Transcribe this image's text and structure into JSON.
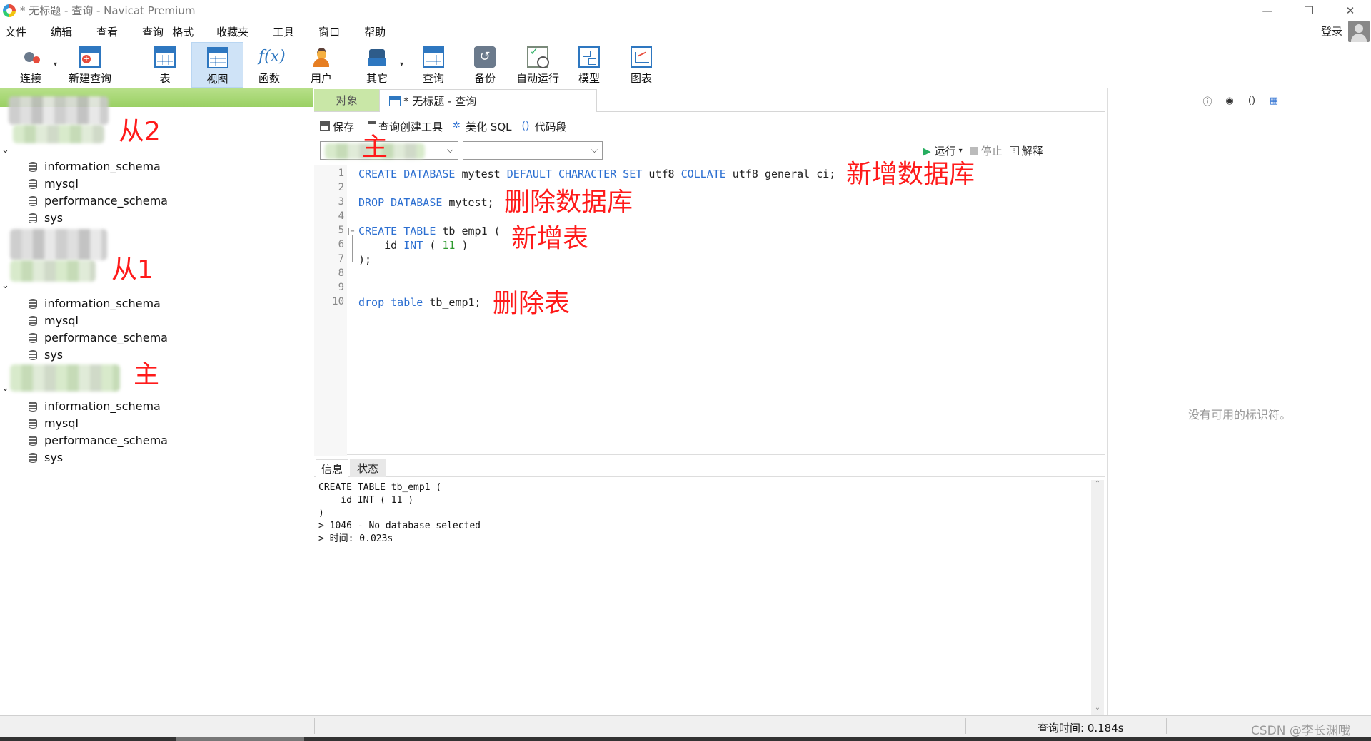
{
  "window": {
    "title": "* 无标题 - 查询 - Navicat Premium",
    "controls": [
      "—",
      "❐",
      "✕"
    ]
  },
  "menu": {
    "items": [
      "文件",
      "编辑",
      "查看",
      "查询",
      "格式",
      "收藏夹",
      "工具",
      "窗口",
      "帮助"
    ],
    "login": "登录"
  },
  "toolbar": {
    "items": [
      {
        "label": "连接",
        "icon": "plug-icon"
      },
      {
        "label": "新建查询",
        "icon": "new-query-icon"
      },
      {
        "label": "表",
        "icon": "table-icon"
      },
      {
        "label": "视图",
        "icon": "view-icon"
      },
      {
        "label": "函数",
        "icon": "function-icon"
      },
      {
        "label": "用户",
        "icon": "user-icon"
      },
      {
        "label": "其它",
        "icon": "other-icon"
      },
      {
        "label": "查询",
        "icon": "query-icon"
      },
      {
        "label": "备份",
        "icon": "backup-icon"
      },
      {
        "label": "自动运行",
        "icon": "auto-run-icon"
      },
      {
        "label": "模型",
        "icon": "model-icon"
      },
      {
        "label": "图表",
        "icon": "chart-icon"
      }
    ],
    "fx_glyph": "f(x)"
  },
  "sidebar": {
    "annotations": {
      "slave2": "从2",
      "slave1": "从1",
      "master": "主"
    },
    "groups": [
      {
        "databases": [
          "information_schema",
          "mysql",
          "performance_schema",
          "sys"
        ]
      },
      {
        "databases": [
          "information_schema",
          "mysql",
          "performance_schema",
          "sys"
        ]
      },
      {
        "databases": [
          "information_schema",
          "mysql",
          "performance_schema",
          "sys"
        ]
      }
    ]
  },
  "tabs": {
    "objects": "对象",
    "query": "* 无标题 - 查询"
  },
  "editor_toolbar": {
    "save": "保存",
    "query_builder": "查询创建工具",
    "beautify": "美化 SQL",
    "snippet": "代码段",
    "run": "运行",
    "stop": "停止",
    "explain": "解释",
    "connection_annotation": "主"
  },
  "code": {
    "line_numbers": [
      "1",
      "2",
      "3",
      "4",
      "5",
      "6",
      "7",
      "8",
      "9",
      "10"
    ],
    "annotations": {
      "create_db": "新增数据库",
      "drop_db": "删除数据库",
      "create_table": "新增表",
      "drop_table": "删除表"
    },
    "l1": {
      "k1": "CREATE DATABASE",
      "t1": " mytest ",
      "k2": "DEFAULT CHARACTER SET",
      "t2": " utf8 ",
      "k3": "COLLATE",
      "t3": " utf8_general_ci;"
    },
    "l3": {
      "k1": "DROP DATABASE",
      "t1": " mytest;"
    },
    "l5": {
      "k1": "CREATE TABLE",
      "t1": " tb_emp1 ("
    },
    "l6": {
      "t0": "    id ",
      "k1": "INT",
      "t1": " ( ",
      "n1": "11",
      "t2": " )"
    },
    "l7": {
      "t0": ");"
    },
    "l10": {
      "k1": "drop table",
      "t1": " tb_emp1;"
    }
  },
  "result": {
    "tabs": [
      "信息",
      "状态"
    ],
    "lines": [
      "CREATE TABLE tb_emp1 (",
      "    id INT ( 11 )",
      ")",
      "> 1046 - No database selected",
      "> 时间: 0.023s"
    ]
  },
  "right_panel": {
    "empty_text": "没有可用的标识符。",
    "icons": [
      "info-icon",
      "eye-icon",
      "braces-icon",
      "grid-icon"
    ]
  },
  "status": {
    "query_time": "查询时间: 0.184s",
    "watermark": "CSDN @李长渊哦"
  }
}
